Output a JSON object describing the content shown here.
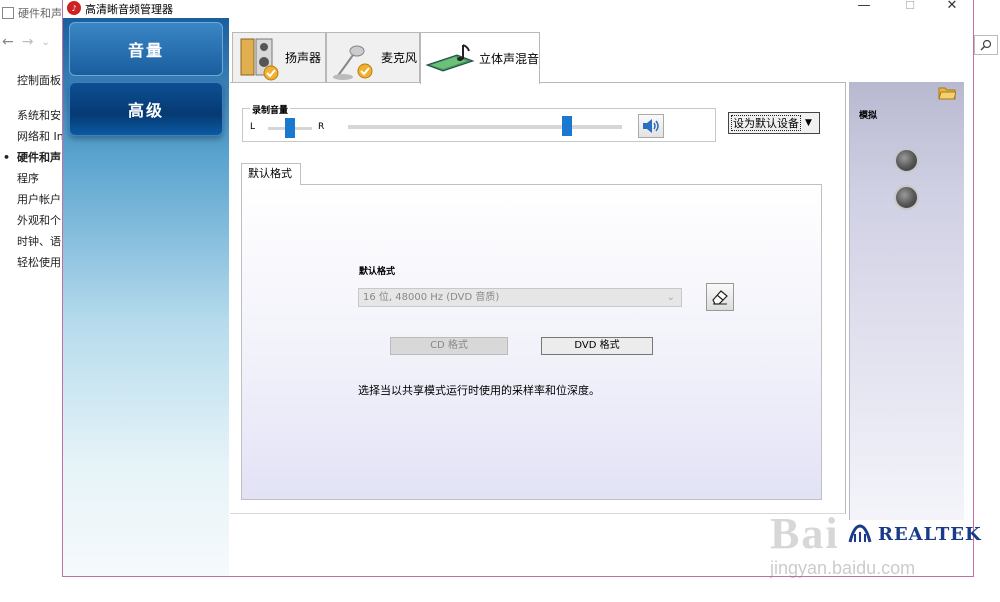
{
  "background_window": {
    "title": "硬件和声",
    "sidebar_items": [
      "控制面板",
      "系统和安",
      "网络和 In",
      "硬件和声",
      "程序",
      "用户帐户",
      "外观和个",
      "时钟、语",
      "轻松使用"
    ],
    "search_icon": "search-icon"
  },
  "window": {
    "title": "高清晰音频管理器",
    "minimize": "—",
    "maximize": "☐",
    "close": "✕"
  },
  "left_nav": {
    "volume_label": "音量",
    "advanced_label": "高级"
  },
  "tabs": [
    {
      "label": "扬声器",
      "icon": "speaker-icon"
    },
    {
      "label": "麦克风",
      "icon": "microphone-icon"
    },
    {
      "label": "立体声混音",
      "icon": "stereo-mix-icon"
    }
  ],
  "recording": {
    "title": "录制音量",
    "left": "L",
    "right": "R",
    "balance": 0.5,
    "volume": 0.8
  },
  "default_device": {
    "label": "设为默认设备",
    "arrow": "▼"
  },
  "format": {
    "tab_label": "默认格式",
    "section_label": "默认格式",
    "selected": "16 位, 48000 Hz (DVD 音质)",
    "cd_button": "CD 格式",
    "dvd_button": "DVD 格式",
    "description": "选择当以共享模式运行时使用的采样率和位深度。"
  },
  "right_panel": {
    "title": "模拟"
  },
  "brand": {
    "name": "REALTEK"
  },
  "watermark": {
    "big": "Bai",
    "small": "jingyan.baidu.com"
  }
}
